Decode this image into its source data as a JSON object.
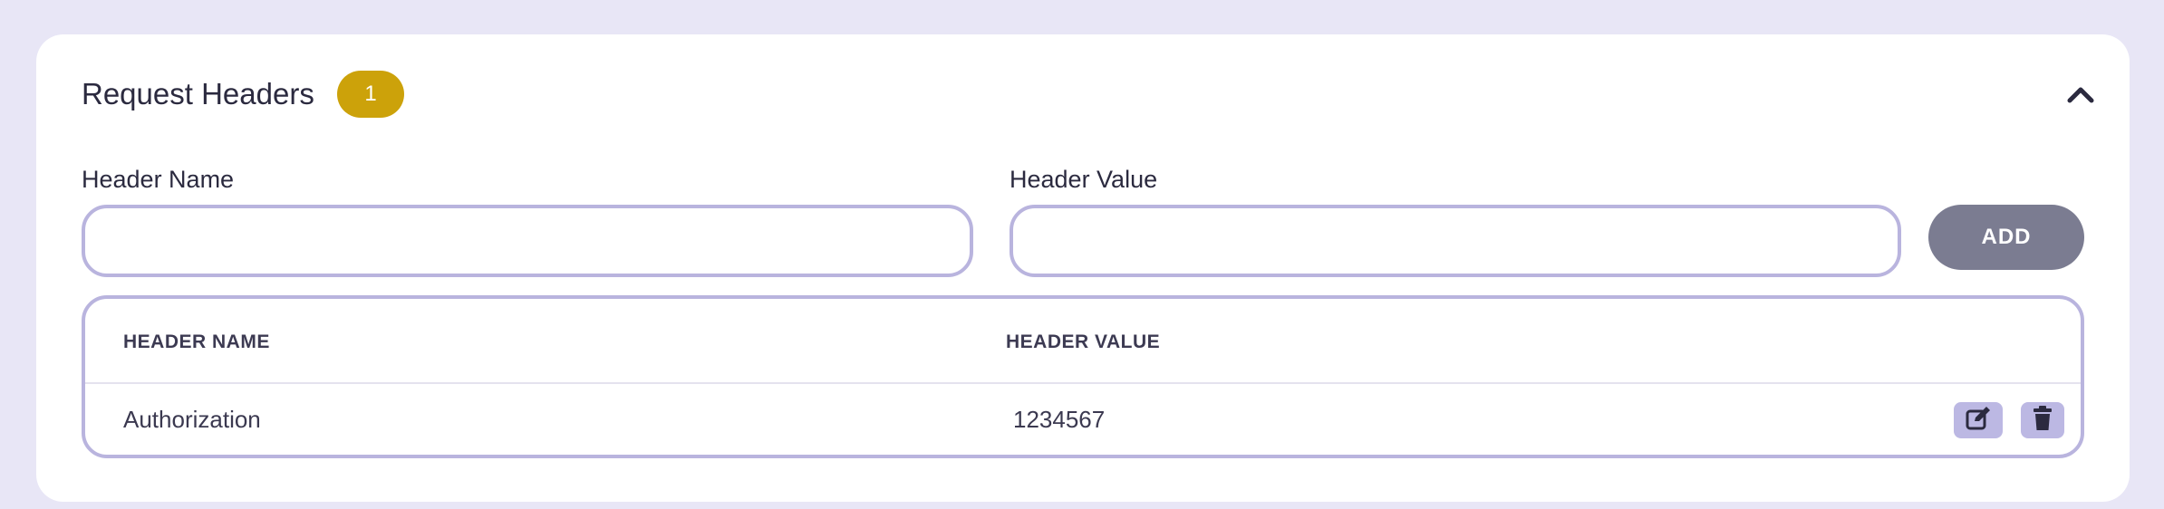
{
  "panel": {
    "title": "Request Headers",
    "count": "1"
  },
  "form": {
    "name_label": "Header Name",
    "value_label": "Header Value",
    "name_value": "",
    "value_value": "",
    "add_label": "ADD"
  },
  "table": {
    "columns": [
      "HEADER NAME",
      "HEADER VALUE"
    ],
    "rows": [
      {
        "name": "Authorization",
        "value": "1234567"
      }
    ]
  },
  "icons": {
    "collapse": "chevron-up-icon",
    "edit": "edit-icon",
    "delete": "trash-icon"
  },
  "colors": {
    "background": "#e8e6f6",
    "badge": "#cca20a",
    "add_button": "#7b7c91",
    "border": "#b9b4de",
    "action_button": "#bcb8e3"
  }
}
